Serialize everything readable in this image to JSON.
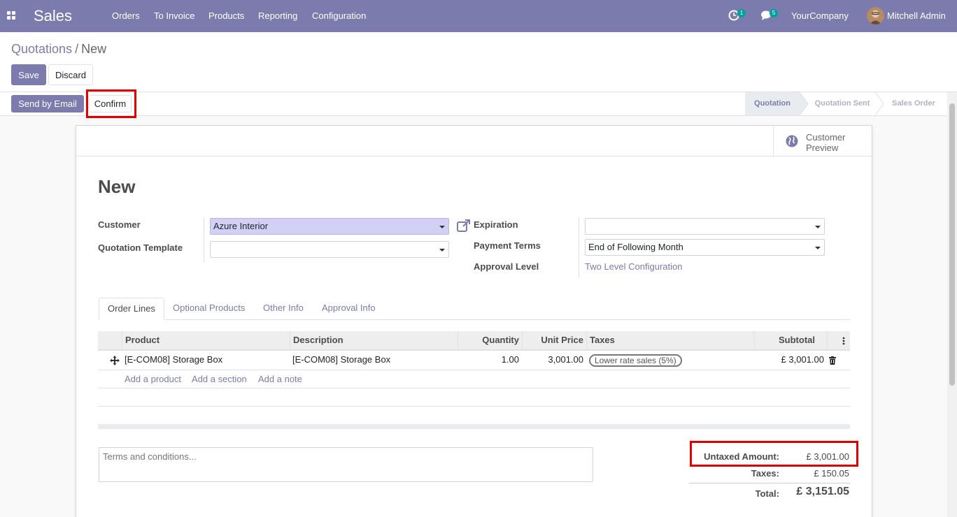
{
  "navbar": {
    "app_name": "Sales",
    "menu": [
      "Orders",
      "To Invoice",
      "Products",
      "Reporting",
      "Configuration"
    ],
    "activity_count": "1",
    "message_count": "5",
    "company": "YourCompany",
    "user": "Mitchell Admin"
  },
  "breadcrumb": {
    "parent": "Quotations",
    "separator": "/",
    "current": "New"
  },
  "control": {
    "save_label": "Save",
    "discard_label": "Discard"
  },
  "statusbar": {
    "send_email_label": "Send by Email",
    "confirm_label": "Confirm",
    "stages": [
      "Quotation",
      "Quotation Sent",
      "Sales Order"
    ],
    "active_stage": "Quotation"
  },
  "sheet": {
    "customer_preview": "Customer Preview",
    "title": "New",
    "fields": {
      "customer_label": "Customer",
      "customer_value": "Azure Interior",
      "template_label": "Quotation Template",
      "template_value": "",
      "expiration_label": "Expiration",
      "expiration_value": "",
      "payment_terms_label": "Payment Terms",
      "payment_terms_value": "End of Following Month",
      "approval_level_label": "Approval Level",
      "approval_level_value": "Two Level Configuration"
    },
    "tabs": [
      "Order Lines",
      "Optional Products",
      "Other Info",
      "Approval Info"
    ],
    "table": {
      "columns": [
        "Product",
        "Description",
        "Quantity",
        "Unit Price",
        "Taxes",
        "Subtotal"
      ],
      "rows": [
        {
          "product": "[E-COM08] Storage Box",
          "description": "[E-COM08] Storage Box",
          "quantity": "1.00",
          "unit_price": "3,001.00",
          "tax": "Lower rate sales (5%)",
          "subtotal": "£ 3,001.00"
        }
      ],
      "add_product": "Add a product",
      "add_section": "Add a section",
      "add_note": "Add a note"
    },
    "terms_placeholder": "Terms and conditions...",
    "totals": {
      "untaxed_label": "Untaxed Amount:",
      "untaxed_value": "£ 3,001.00",
      "taxes_label": "Taxes:",
      "taxes_value": "£ 150.05",
      "total_label": "Total:",
      "total_value": "£ 3,151.05"
    }
  },
  "colors": {
    "brand": "#7c7bad",
    "highlight": "#e00000",
    "teal_badge": "#00a09d"
  }
}
